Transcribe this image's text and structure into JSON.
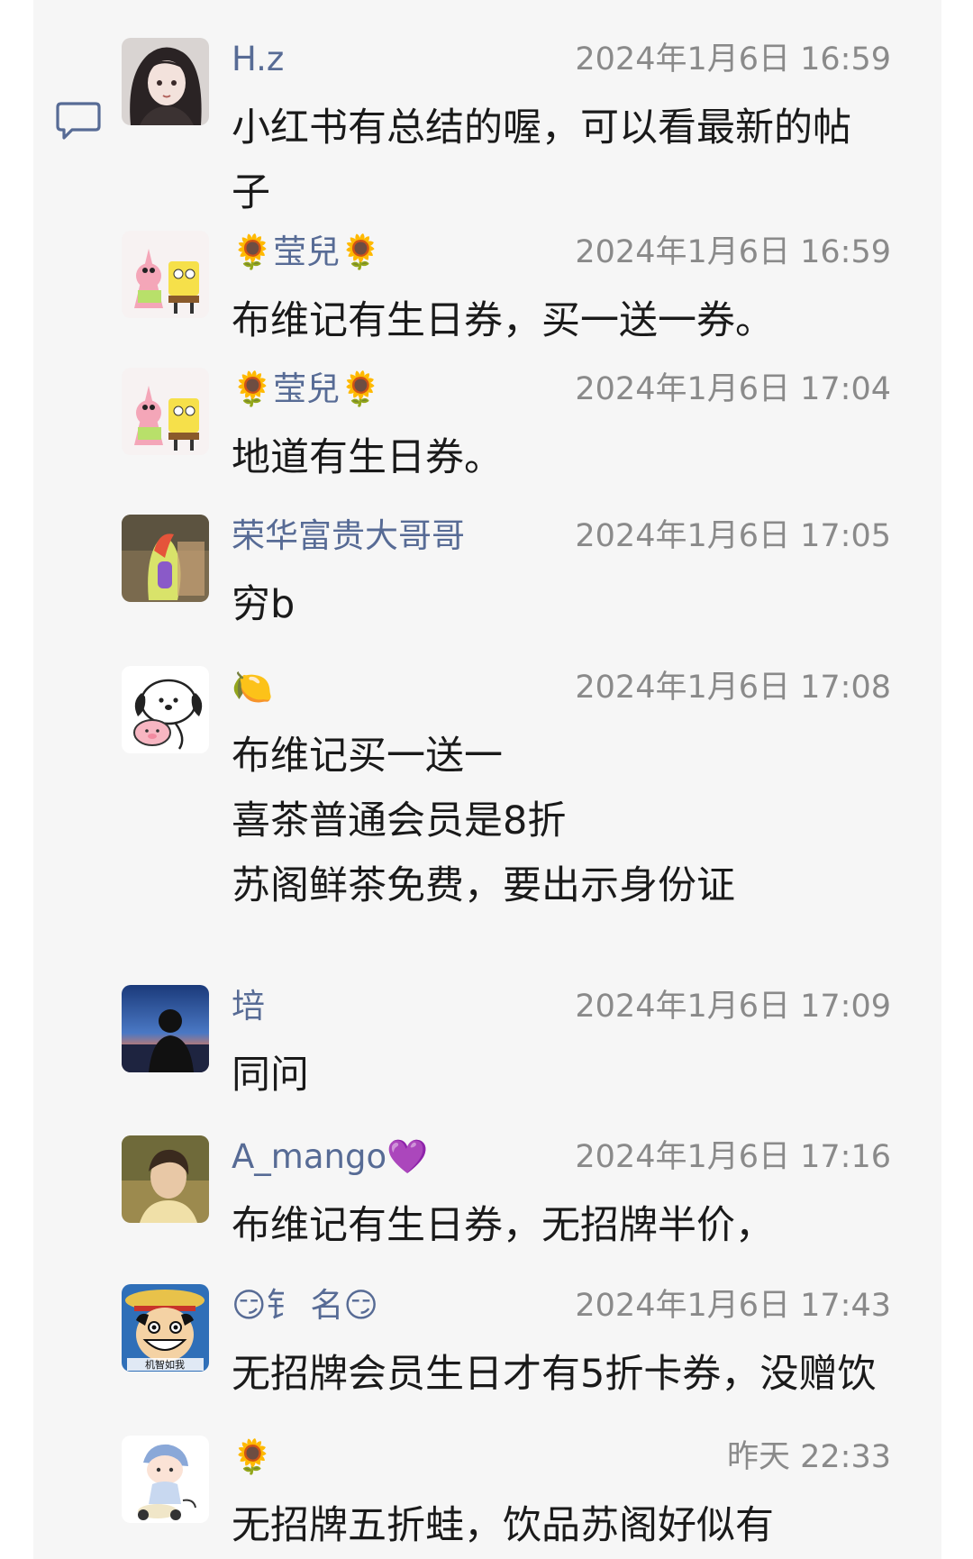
{
  "comments": [
    {
      "name": "H.z",
      "time": "2024年1月6日 16:59",
      "lines": [
        "小红书有总结的喔，可以看最新的帖",
        "子"
      ],
      "avatar": "girl-avatar"
    },
    {
      "name": "🌻莹兒🌻",
      "time": "2024年1月6日 16:59",
      "lines": [
        "布维记有生日券，买一送一券。"
      ],
      "avatar": "patrick-spongebob-avatar"
    },
    {
      "name": "🌻莹兒🌻",
      "time": "2024年1月6日 17:04",
      "lines": [
        "地道有生日券。"
      ],
      "avatar": "patrick-spongebob-avatar"
    },
    {
      "name": "荣华富贵大哥哥",
      "time": "2024年1月6日 17:05",
      "lines": [
        "穷b"
      ],
      "avatar": "toy-avatar"
    },
    {
      "name": "🍋",
      "time": "2024年1月6日 17:08",
      "lines": [
        "布维记买一送一",
        "喜茶普通会员是8折",
        "苏阁鲜茶免费，要出示身份证"
      ],
      "avatar": "pochacco-avatar"
    },
    {
      "name": "培",
      "time": "2024年1月6日 17:09",
      "lines": [
        "同问"
      ],
      "avatar": "sunset-silhouette-avatar"
    },
    {
      "name": "A_mango💜",
      "time": "2024年1月6日 17:16",
      "lines": [
        "布维记有生日券，无招牌半价，"
      ],
      "avatar": "portrait-avatar"
    },
    {
      "name": "😏钅 名😏",
      "time": "2024年1月6日 17:43",
      "lines": [
        "无招牌会员生日才有5折卡券，没赠饮"
      ],
      "avatar": "luffy-avatar",
      "avatar_text": "机智如我"
    },
    {
      "name": "🌻",
      "time": "昨天 22:33",
      "lines": [
        "无招牌五折蛙，饮品苏阁好似有"
      ],
      "avatar": "cartoon-girl-avatar"
    }
  ],
  "colors": {
    "name": "#576b95",
    "time": "#8a8a8a",
    "text": "#1a1a1a",
    "panel": "#f6f6f6"
  },
  "icons": {
    "comment": "comment-bubble-icon"
  }
}
